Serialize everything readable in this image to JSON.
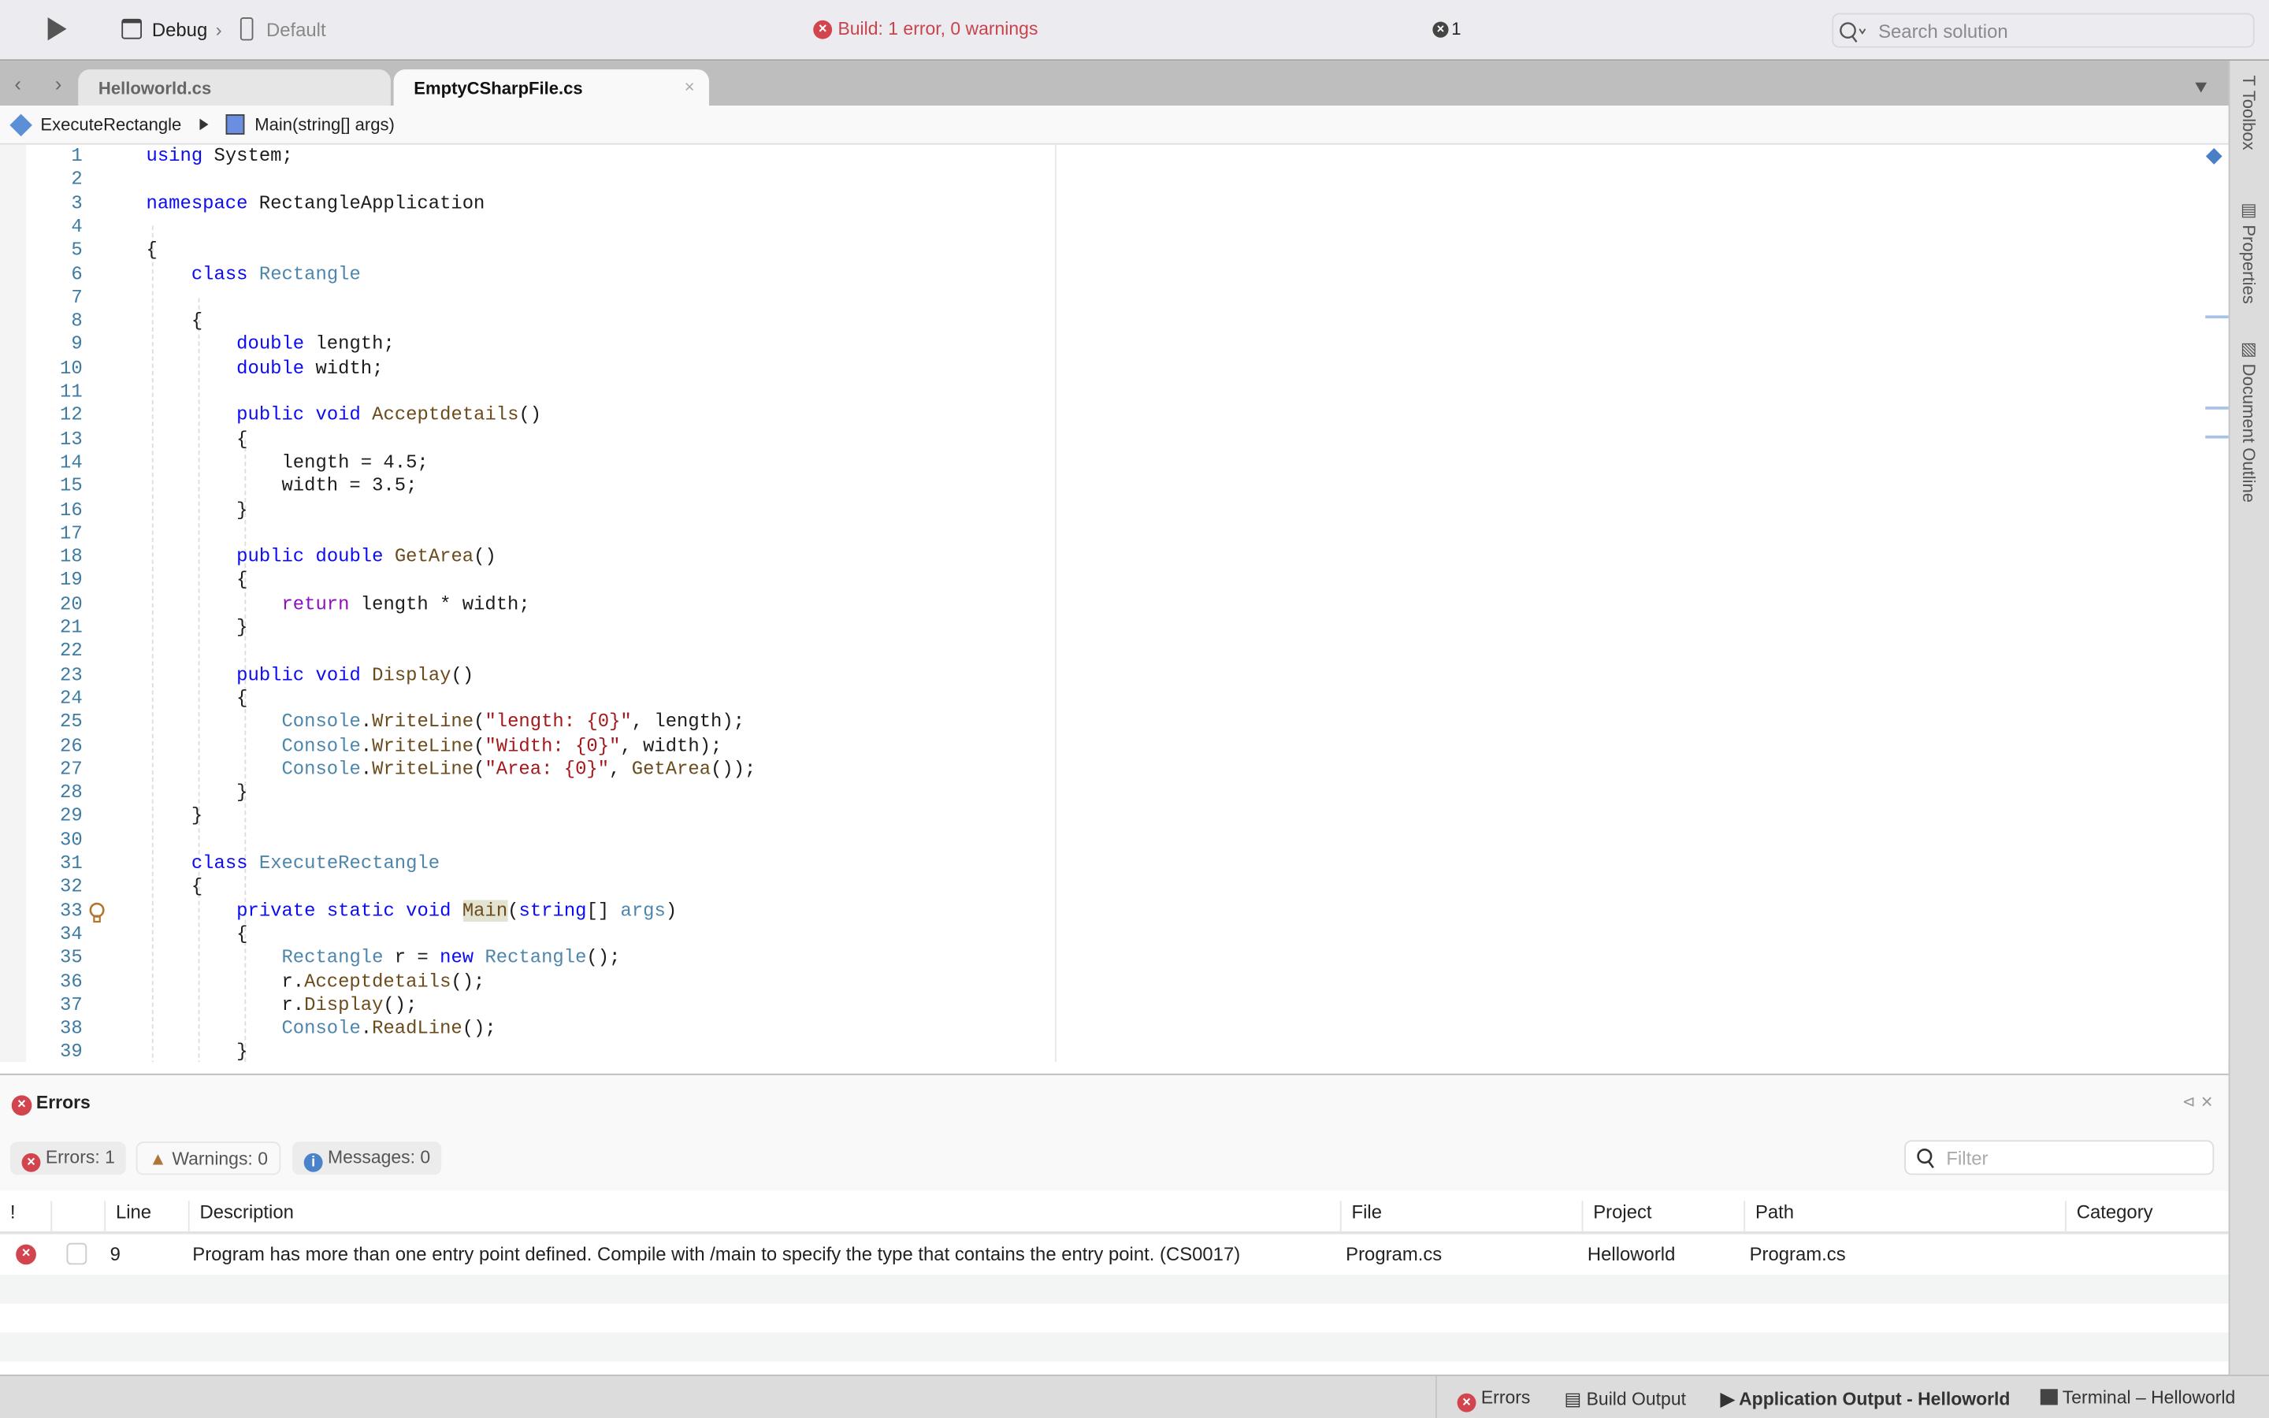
{
  "toolbar": {
    "config": "Debug",
    "separator": "›",
    "device": "Default",
    "build_status": "Build: 1 error, 0 warnings",
    "error_count": "1",
    "search_placeholder": "Search solution"
  },
  "tabs": [
    {
      "label": "Helloworld.cs",
      "active": false
    },
    {
      "label": "EmptyCSharpFile.cs",
      "active": true
    }
  ],
  "breadcrumb": {
    "class": "ExecuteRectangle",
    "method": "Main(string[] args)"
  },
  "sidebar": {
    "items": [
      "Toolbox",
      "Properties",
      "Document Outline"
    ]
  },
  "colors": {
    "keyword": "#0c0cf2",
    "type": "#4d86ad",
    "method": "#6b4b1c",
    "string": "#a5171b",
    "control": "#8d10c0",
    "error": "#d2454f"
  },
  "code": [
    [
      [
        "k",
        "using"
      ],
      [
        "p",
        " System;"
      ]
    ],
    [],
    [
      [
        "k",
        "namespace"
      ],
      [
        "p",
        " RectangleApplication"
      ]
    ],
    [],
    [
      [
        "p",
        "{"
      ]
    ],
    [
      [
        "p",
        "    "
      ],
      [
        "k",
        "class"
      ],
      [
        "p",
        " "
      ],
      [
        "t",
        "Rectangle"
      ]
    ],
    [],
    [
      [
        "p",
        "    {"
      ]
    ],
    [
      [
        "p",
        "        "
      ],
      [
        "k",
        "double"
      ],
      [
        "p",
        " length;"
      ]
    ],
    [
      [
        "p",
        "        "
      ],
      [
        "k",
        "double"
      ],
      [
        "p",
        " width;"
      ]
    ],
    [],
    [
      [
        "p",
        "        "
      ],
      [
        "k",
        "public"
      ],
      [
        "p",
        " "
      ],
      [
        "k",
        "void"
      ],
      [
        "p",
        " "
      ],
      [
        "m",
        "Acceptdetails"
      ],
      [
        "p",
        "()"
      ]
    ],
    [
      [
        "p",
        "        {"
      ]
    ],
    [
      [
        "p",
        "            length = 4.5;"
      ]
    ],
    [
      [
        "p",
        "            width = 3.5;"
      ]
    ],
    [
      [
        "p",
        "        }"
      ]
    ],
    [],
    [
      [
        "p",
        "        "
      ],
      [
        "k",
        "public"
      ],
      [
        "p",
        " "
      ],
      [
        "k",
        "double"
      ],
      [
        "p",
        " "
      ],
      [
        "m",
        "GetArea"
      ],
      [
        "p",
        "()"
      ]
    ],
    [
      [
        "p",
        "        {"
      ]
    ],
    [
      [
        "p",
        "            "
      ],
      [
        "r",
        "return"
      ],
      [
        "p",
        " length * width;"
      ]
    ],
    [
      [
        "p",
        "        }"
      ]
    ],
    [],
    [
      [
        "p",
        "        "
      ],
      [
        "k",
        "public"
      ],
      [
        "p",
        " "
      ],
      [
        "k",
        "void"
      ],
      [
        "p",
        " "
      ],
      [
        "m",
        "Display"
      ],
      [
        "p",
        "()"
      ]
    ],
    [
      [
        "p",
        "        {"
      ]
    ],
    [
      [
        "p",
        "            "
      ],
      [
        "t",
        "Console"
      ],
      [
        "p",
        "."
      ],
      [
        "m",
        "WriteLine"
      ],
      [
        "p",
        "("
      ],
      [
        "s",
        "\"length: {0}\""
      ],
      [
        "p",
        ", length);"
      ]
    ],
    [
      [
        "p",
        "            "
      ],
      [
        "t",
        "Console"
      ],
      [
        "p",
        "."
      ],
      [
        "m",
        "WriteLine"
      ],
      [
        "p",
        "("
      ],
      [
        "s",
        "\"Width: {0}\""
      ],
      [
        "p",
        ", width);"
      ]
    ],
    [
      [
        "p",
        "            "
      ],
      [
        "t",
        "Console"
      ],
      [
        "p",
        "."
      ],
      [
        "m",
        "WriteLine"
      ],
      [
        "p",
        "("
      ],
      [
        "s",
        "\"Area: {0}\""
      ],
      [
        "p",
        ", "
      ],
      [
        "m",
        "GetArea"
      ],
      [
        "p",
        "());"
      ]
    ],
    [
      [
        "p",
        "        }"
      ]
    ],
    [
      [
        "p",
        "    }"
      ]
    ],
    [],
    [
      [
        "p",
        "    "
      ],
      [
        "k",
        "class"
      ],
      [
        "p",
        " "
      ],
      [
        "t",
        "ExecuteRectangle"
      ]
    ],
    [
      [
        "p",
        "    {"
      ]
    ],
    [
      [
        "p",
        "        "
      ],
      [
        "k",
        "private"
      ],
      [
        "p",
        " "
      ],
      [
        "k",
        "static"
      ],
      [
        "p",
        " "
      ],
      [
        "k",
        "void"
      ],
      [
        "p",
        " "
      ],
      [
        "mh",
        "Main"
      ],
      [
        "p",
        "("
      ],
      [
        "k",
        "string"
      ],
      [
        "p",
        "[] "
      ],
      [
        "t",
        "args"
      ],
      [
        "p",
        ")"
      ]
    ],
    [
      [
        "p",
        "        {"
      ]
    ],
    [
      [
        "p",
        "            "
      ],
      [
        "t",
        "Rectangle"
      ],
      [
        "p",
        " r = "
      ],
      [
        "k",
        "new"
      ],
      [
        "p",
        " "
      ],
      [
        "t",
        "Rectangle"
      ],
      [
        "p",
        "();"
      ]
    ],
    [
      [
        "p",
        "            r."
      ],
      [
        "m",
        "Acceptdetails"
      ],
      [
        "p",
        "();"
      ]
    ],
    [
      [
        "p",
        "            r."
      ],
      [
        "m",
        "Display"
      ],
      [
        "p",
        "();"
      ]
    ],
    [
      [
        "p",
        "            "
      ],
      [
        "t",
        "Console"
      ],
      [
        "p",
        "."
      ],
      [
        "m",
        "ReadLine"
      ],
      [
        "p",
        "();"
      ]
    ],
    [
      [
        "p",
        "        }"
      ]
    ]
  ],
  "errors_pad": {
    "title": "Errors",
    "filters": {
      "errors": "Errors: 1",
      "warnings": "Warnings: 0",
      "messages": "Messages: 0"
    },
    "filter_placeholder": "Filter",
    "columns": [
      "!",
      "",
      "Line",
      "Description",
      "File",
      "Project",
      "Path",
      "Category"
    ],
    "rows": [
      {
        "line": "9",
        "description": "Program has more than one entry point defined. Compile with /main to specify the type that contains the entry point. (CS0017)",
        "file": "Program.cs",
        "project": "Helloworld",
        "path": "Program.cs",
        "category": ""
      }
    ]
  },
  "statusbar": {
    "items": [
      "Errors",
      "Build Output",
      "Application Output - Helloworld",
      "Terminal – Helloworld"
    ]
  }
}
